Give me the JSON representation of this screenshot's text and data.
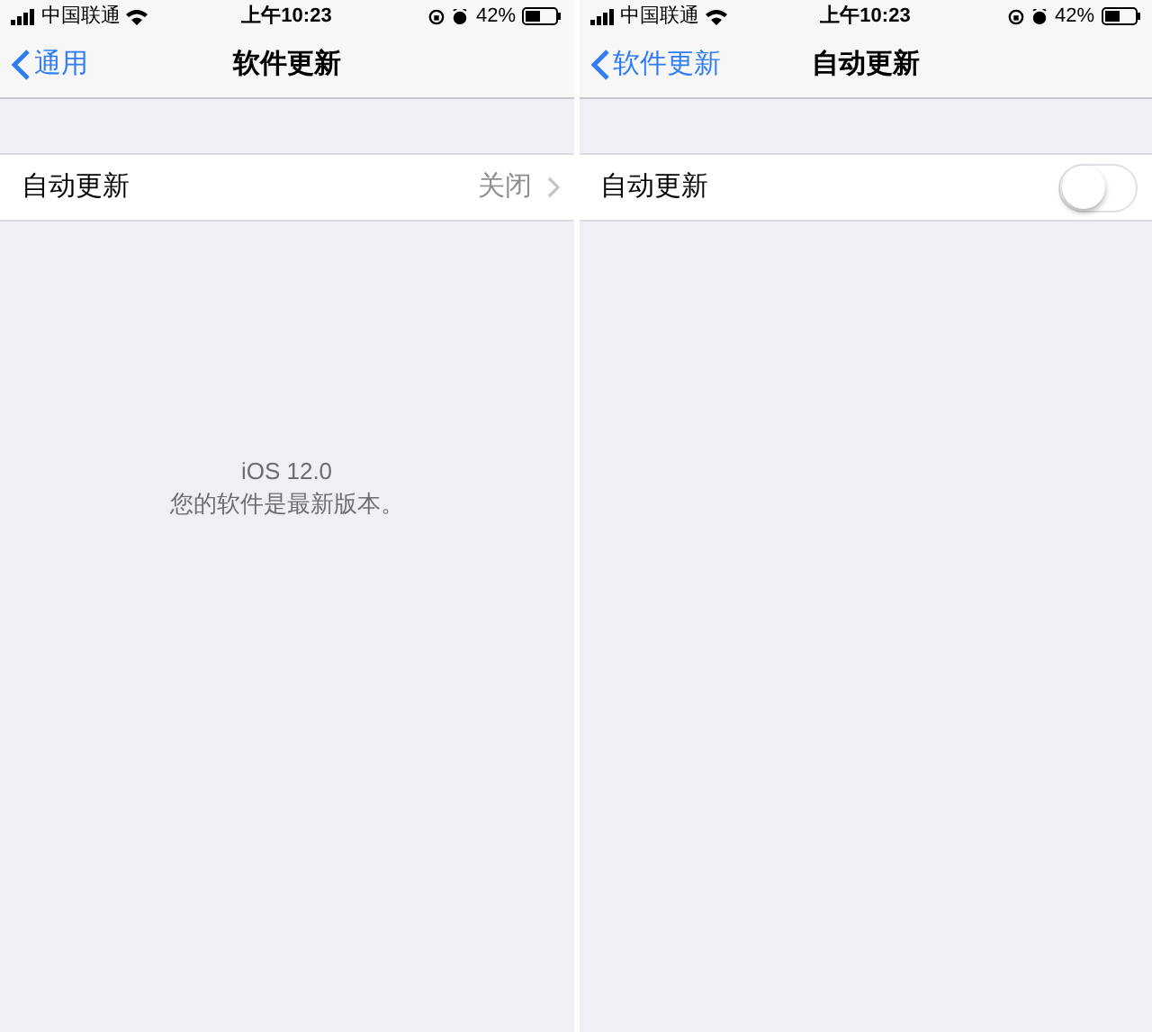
{
  "screens": [
    {
      "status_bar": {
        "carrier": "中国联通",
        "time": "上午10:23",
        "battery": "42%"
      },
      "nav": {
        "back": "通用",
        "title": "软件更新"
      },
      "row": {
        "kind": "value",
        "label": "自动更新",
        "value": "关闭"
      },
      "footer": {
        "version": "iOS 12.0",
        "message": "您的软件是最新版本。"
      }
    },
    {
      "status_bar": {
        "carrier": "中国联通",
        "time": "上午10:23",
        "battery": "42%"
      },
      "nav": {
        "back": "软件更新",
        "title": "自动更新"
      },
      "row": {
        "kind": "toggle",
        "label": "自动更新",
        "on": false
      }
    }
  ]
}
